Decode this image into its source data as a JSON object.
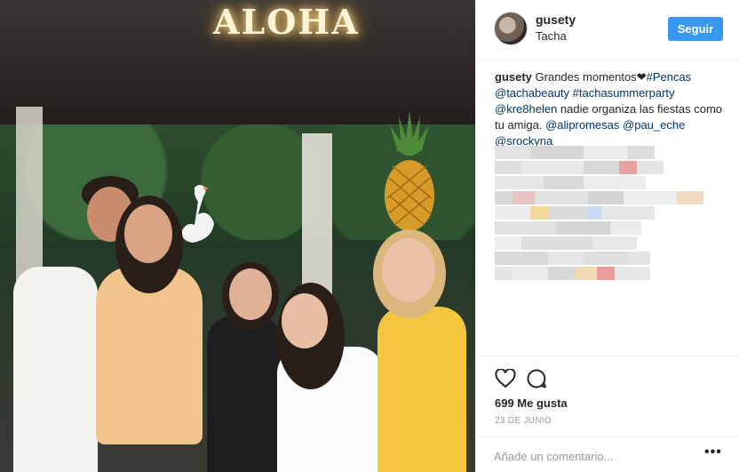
{
  "photo": {
    "sign_text": "ALOHA"
  },
  "header": {
    "username": "gusety",
    "location": "Tacha",
    "follow_label": "Seguir"
  },
  "caption": {
    "username": "gusety",
    "text_intro": "Grandes momentos❤",
    "tag_pencas": "#Pencas",
    "mention_tachabeauty": "@tachabeauty",
    "tag_tachasummerparty": "#tachasummerparty",
    "mention_kre8helen": "@kre8helen",
    "text_mid": "nadie organiza las fiestas como tu amiga.",
    "mention_alipromesas": "@alipromesas",
    "mention_pau_eche": "@pau_eche",
    "mention_srockyna": "@srockyna"
  },
  "actions": {
    "likes": "699 Me gusta",
    "date": "23 DE JUNIO",
    "comment_placeholder": "Añade un comentario...",
    "more_label": "•••"
  },
  "colors": {
    "accent": "#3897f0",
    "link": "#003569",
    "text": "#262626",
    "muted": "#999999"
  }
}
